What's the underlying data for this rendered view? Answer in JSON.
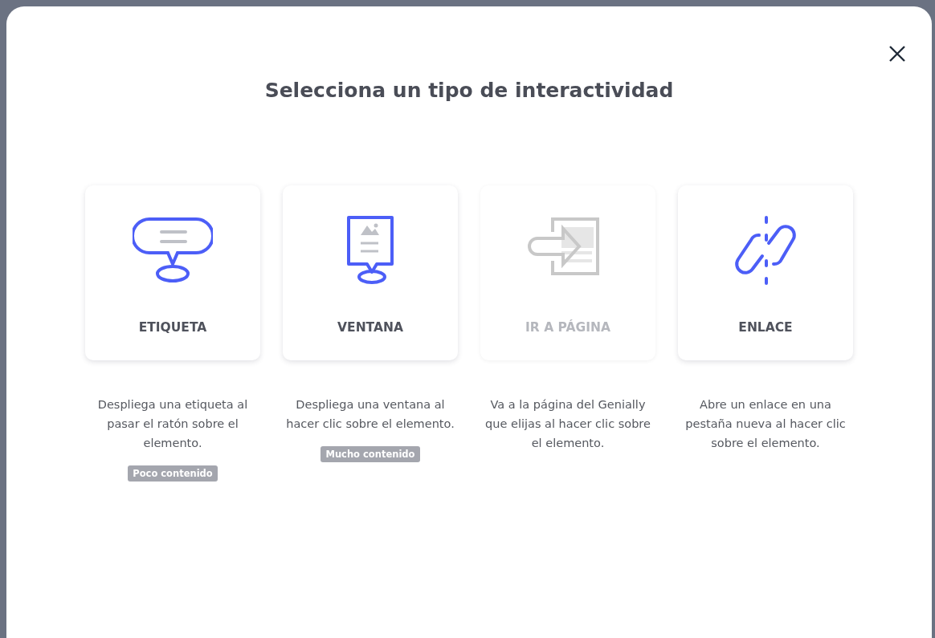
{
  "dialog": {
    "title": "Selecciona un tipo de interactividad"
  },
  "options": [
    {
      "kind": "label",
      "label": "ETIQUETA",
      "disabled": false,
      "description": "Despliega una etiqueta al pasar el ratón sobre el elemento.",
      "badge": "Poco contenido"
    },
    {
      "kind": "window",
      "label": "VENTANA",
      "disabled": false,
      "description": "Despliega una ventana al hacer clic sobre el elemento.",
      "badge": "Mucho contenido"
    },
    {
      "kind": "page",
      "label": "IR A PÁGINA",
      "disabled": true,
      "description": "Va a la página del Genially que elijas al hacer clic sobre el elemento."
    },
    {
      "kind": "link",
      "label": "ENLACE",
      "disabled": false,
      "description": "Abre un enlace en una pestaña nueva al hacer clic sobre el elemento."
    }
  ]
}
